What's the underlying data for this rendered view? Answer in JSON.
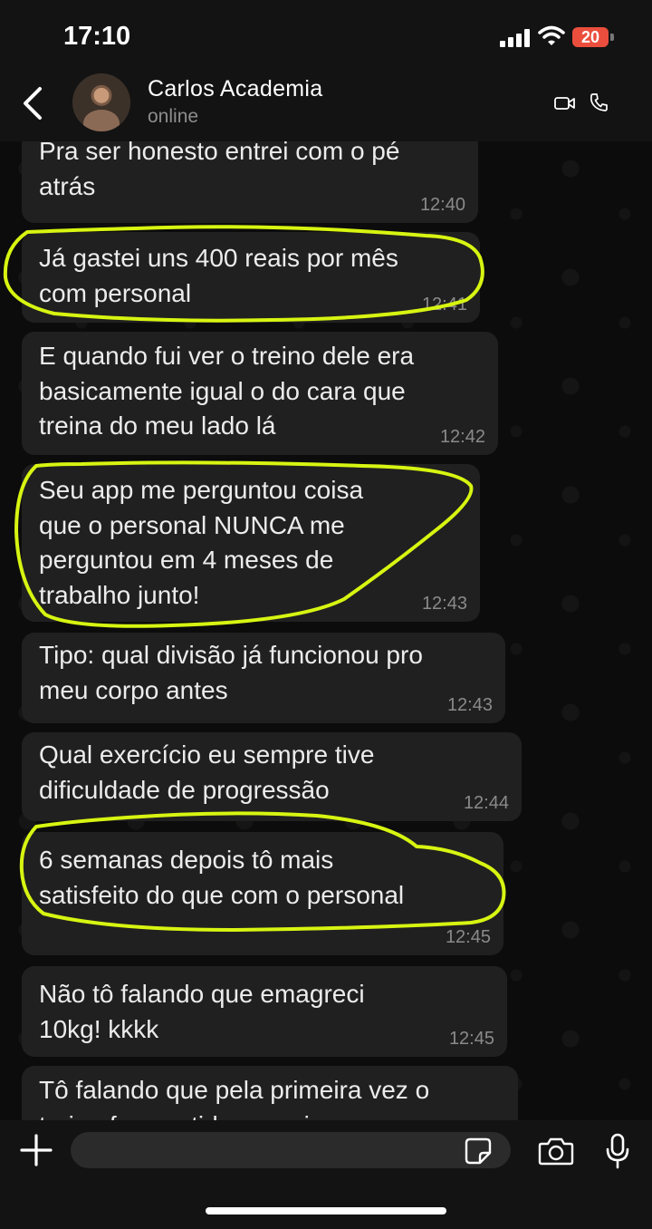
{
  "status_bar": {
    "time": "17:10",
    "battery": "20",
    "icons": [
      "signal-icon",
      "wifi-icon",
      "battery-icon"
    ]
  },
  "header": {
    "contact_name": "Carlos Academia",
    "contact_status": "online",
    "icons": [
      "back-icon",
      "avatar",
      "video-call-icon",
      "phone-call-icon"
    ]
  },
  "messages": [
    {
      "text": "Pra ser honesto entrei com o pé\natrás",
      "time": "12:40"
    },
    {
      "text": "Já gastei uns 400 reais por mês\ncom personal",
      "time": "12:41"
    },
    {
      "text": "E quando fui ver o treino dele era\nbasicamente igual o do cara que\ntreina do meu lado lá",
      "time": "12:42"
    },
    {
      "text": "Seu app me perguntou coisa\nque o personal NUNCA me\nperguntou em 4 meses de\ntrabalho junto!",
      "time": "12:43"
    },
    {
      "text": "Tipo: qual divisão já funcionou pro\nmeu corpo antes",
      "time": "12:43"
    },
    {
      "text": "Qual exercício eu sempre tive\ndificuldade de progressão",
      "time": "12:44"
    },
    {
      "text": "6 semanas depois tô mais\nsatisfeito do que com o personal",
      "time": "12:45"
    },
    {
      "text": "Não tô falando que emagreci\n10kg! kkkk",
      "time": "12:45"
    },
    {
      "text": "Tô falando que pela primeira vez o\ntreino faz sentido pra mim",
      "time": ""
    }
  ],
  "colors": {
    "background": "#0b0b0b",
    "bubble": "#202020",
    "highlight": "#d7f511",
    "battery": "#eb4e3d"
  },
  "input_bar": {
    "placeholder": "",
    "icons": [
      "plus-icon",
      "sticker-icon",
      "camera-icon",
      "microphone-icon"
    ]
  }
}
